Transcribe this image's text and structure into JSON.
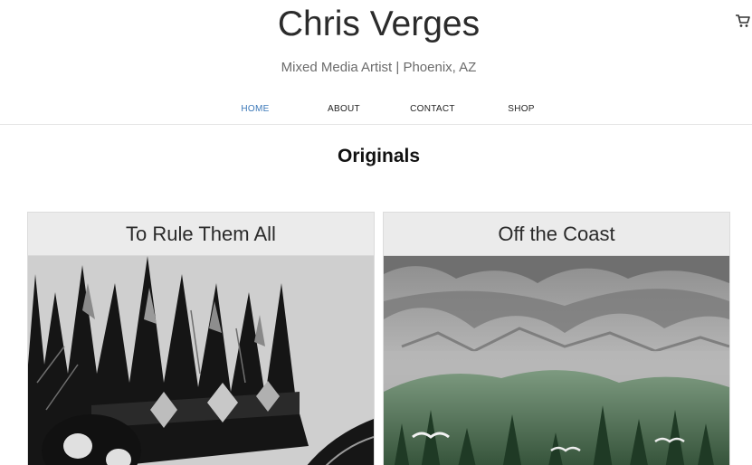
{
  "header": {
    "title": "Chris Verges",
    "subtitle": "Mixed Media Artist | Phoenix, AZ",
    "cart_icon": "shopping-cart-icon"
  },
  "nav": {
    "items": [
      {
        "label": "HOME",
        "active": true
      },
      {
        "label": "ABOUT",
        "active": false
      },
      {
        "label": "CONTACT",
        "active": false
      },
      {
        "label": "SHOP",
        "active": false
      }
    ]
  },
  "main": {
    "section_title": "Originals",
    "cards": [
      {
        "title": "To Rule Them All"
      },
      {
        "title": "Off the Coast"
      }
    ]
  },
  "colors": {
    "accent": "#3a77b8",
    "card_header_bg": "#ebebeb"
  }
}
